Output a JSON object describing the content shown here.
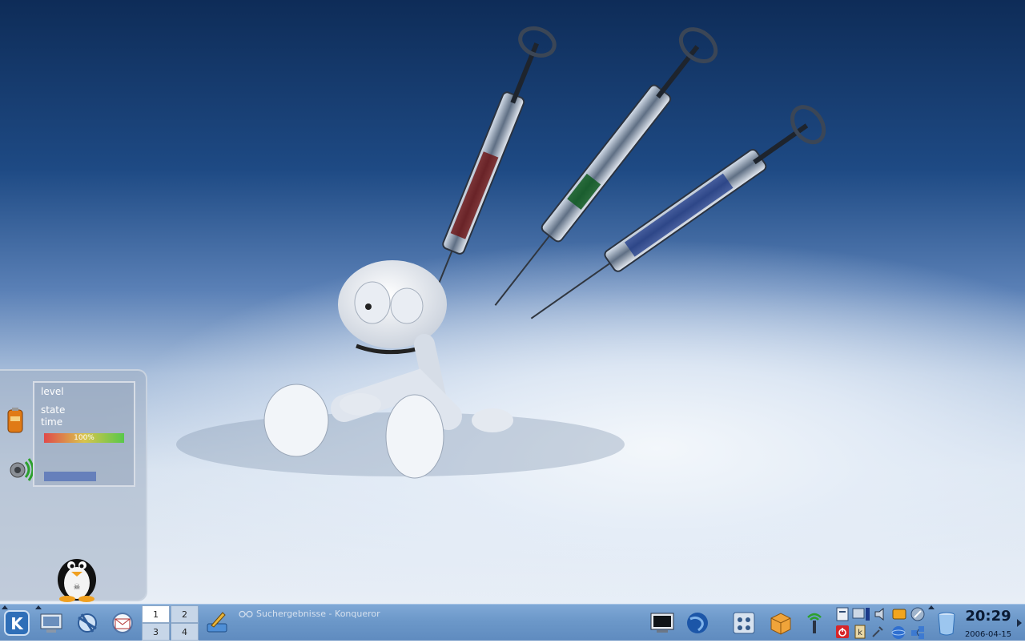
{
  "battery_widget": {
    "level_label": "level",
    "state_label": "state",
    "time_label": "time",
    "level_percent_text": "100%",
    "level_percent": 100,
    "volume_percent": 65
  },
  "pager": {
    "desktops": [
      "1",
      "2",
      "3",
      "4"
    ],
    "active": "1"
  },
  "taskbar": {
    "window_title": "Suchergebnisse - Konqueror"
  },
  "clock": {
    "time": "20:29",
    "date": "2006-04-15"
  },
  "icons": {
    "kmenu": "kde-menu-icon",
    "launchers": [
      "desktop-icon",
      "konqueror-icon",
      "kmail-icon",
      "kate-icon"
    ],
    "quick": [
      "terminal-icon",
      "browser-globe-icon",
      "system-settings-icon",
      "package-icon",
      "wireless-icon"
    ],
    "tray": [
      "klipper-icon",
      "display-icon",
      "volume-icon",
      "kmix-icon",
      "kget-icon",
      "power-icon",
      "kwallet-icon",
      "network-icon",
      "update-icon",
      "trash-icon"
    ]
  },
  "colors": {
    "taskbar": "#6c98c9",
    "level_bar_low": "#e04a4a",
    "level_bar_high": "#58c84a",
    "volume_bar": "#6680bb"
  }
}
